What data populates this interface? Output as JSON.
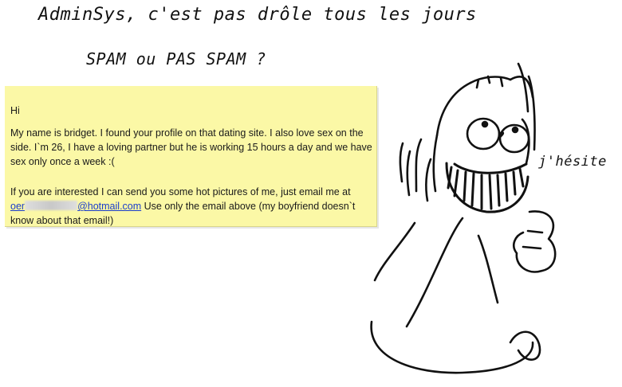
{
  "header": {
    "title": "AdminSys, c'est pas drôle tous les jours",
    "subtitle": "SPAM ou PAS SPAM ?"
  },
  "character": {
    "speech": "j'hésite"
  },
  "email": {
    "greeting": "Hi",
    "paragraph1": "My name is bridget. I found your profile on that dating site. I also love sex on the side. I`m 26, I have a loving partner but he is working 15 hours a day and we have sex only once a week :(",
    "paragraph2_intro": "If you are interested I can send you some hot pictures of me, just email me at",
    "address_start": "oer",
    "address_domain": "@hotmail.com",
    "paragraph2_outro": " Use only the email above (my boyfriend doesn`t know about that email!)"
  },
  "colors": {
    "note_background": "#fbf8a6",
    "link": "#1a3dcc",
    "ink": "#111111"
  }
}
